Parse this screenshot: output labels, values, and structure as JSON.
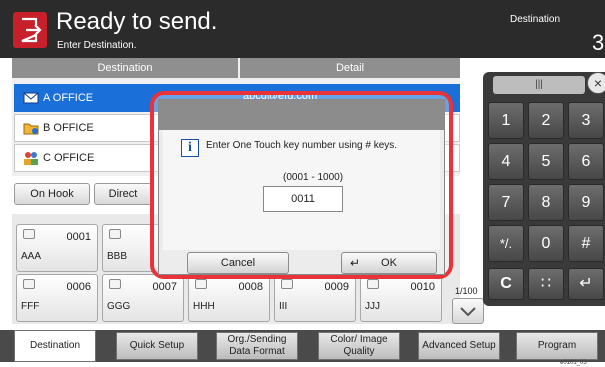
{
  "header": {
    "title": "Ready to send.",
    "subtitle": "Enter Destination.",
    "destination_label": "Destination",
    "destination_count": "3"
  },
  "table": {
    "col_destination": "Destination",
    "col_detail": "Detail",
    "rows": [
      {
        "name": "A OFFICE",
        "detail": "abcd@efg.com",
        "icon": "email-icon"
      },
      {
        "name": "B OFFICE",
        "detail": "",
        "icon": "folder-icon"
      },
      {
        "name": "C OFFICE",
        "detail": "",
        "icon": "group-icon"
      }
    ]
  },
  "buttons": {
    "on_hook": "On Hook",
    "direct": "Direct"
  },
  "one_touch_keys": [
    {
      "number": "0001",
      "name": "AAA"
    },
    {
      "number": "",
      "name": "BBB"
    },
    {
      "number": "0006",
      "name": "FFF"
    },
    {
      "number": "0007",
      "name": "GGG"
    },
    {
      "number": "0008",
      "name": "HHH"
    },
    {
      "number": "0009",
      "name": "III"
    },
    {
      "number": "0010",
      "name": "JJJ"
    }
  ],
  "pager": "1/100",
  "keypad": {
    "keys": [
      "1",
      "2",
      "3",
      "4",
      "5",
      "6",
      "7",
      "8",
      "9",
      "*/.",
      "0",
      "#",
      "C",
      "∷",
      "↵"
    ]
  },
  "dialog": {
    "message": "Enter One Touch key number using # keys.",
    "range": "(0001 - 1000)",
    "value": "0011",
    "cancel": "Cancel",
    "ok": "OK"
  },
  "tabs": [
    {
      "label": "Destination"
    },
    {
      "label": "Quick Setup"
    },
    {
      "label": "Org./Sending Data Format"
    },
    {
      "label": "Color/ Image Quality"
    },
    {
      "label": "Advanced Setup"
    },
    {
      "label": "Program"
    }
  ],
  "figure_id": "e0101_03",
  "colors": {
    "accent_red": "#e8333a",
    "selection_blue": "#1a6fd8",
    "header_dark": "#2b2b2b"
  }
}
